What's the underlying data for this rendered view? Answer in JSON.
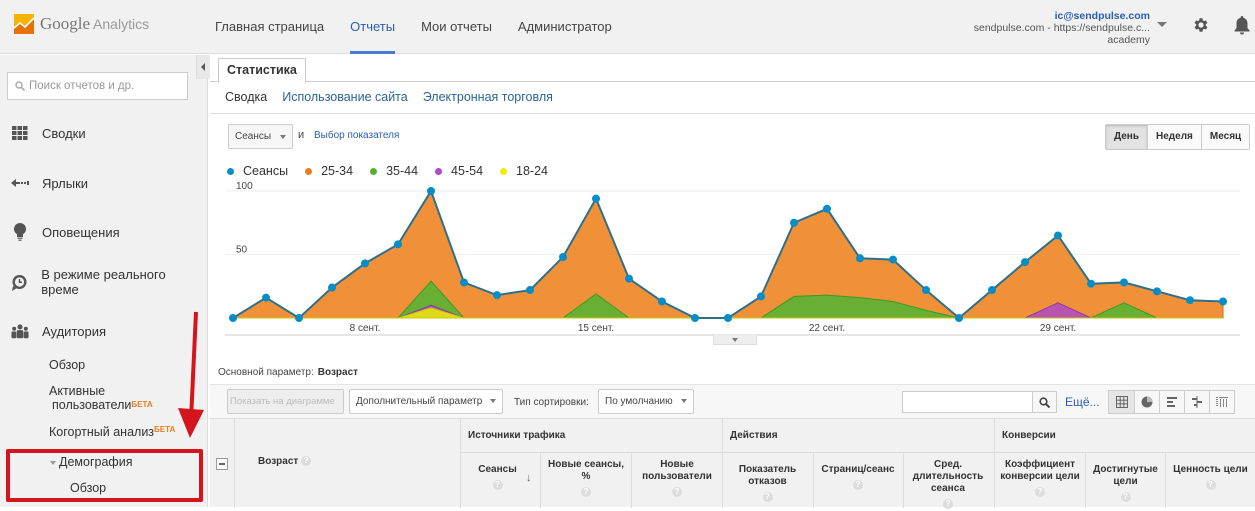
{
  "header": {
    "logo_google": "Google",
    "logo_product": "Analytics",
    "nav": [
      {
        "label": "Главная страница",
        "active": false
      },
      {
        "label": "Отчеты",
        "active": true
      },
      {
        "label": "Мои отчеты",
        "active": false
      },
      {
        "label": "Администратор",
        "active": false
      }
    ],
    "account_email": "ic@sendpulse.com",
    "account_property": "sendpulse.com - https://sendpulse.c...",
    "account_view": "academy"
  },
  "sidebar": {
    "search_placeholder": "Поиск отчетов и др.",
    "items": [
      {
        "label": "Сводки",
        "icon": "grid-icon"
      },
      {
        "label": "Ярлыки",
        "icon": "shortcut-arrow-icon"
      },
      {
        "label": "Оповещения",
        "icon": "lightbulb-icon"
      },
      {
        "label": "В режиме реального време",
        "icon": "clock-icon"
      },
      {
        "label": "Аудитория",
        "icon": "people-icon"
      }
    ],
    "audience_sub": {
      "overview": "Обзор",
      "active_users_1": "Активные",
      "active_users_2": "пользователи",
      "cohort": "Когортный анализ",
      "beta": "БЕТА",
      "demographics": "Демография",
      "demographics_overview": "Обзор"
    }
  },
  "main": {
    "tab": "Статистика",
    "subtabs": [
      {
        "label": "Сводка",
        "active": true
      },
      {
        "label": "Использование сайта",
        "active": false
      },
      {
        "label": "Электронная торговля",
        "active": false
      }
    ],
    "metric_select": "Сеансы",
    "and_label": "и",
    "choose_metric": "Выбор показателя",
    "period": [
      "День",
      "Неделя",
      "Месяц"
    ],
    "period_selected": "День",
    "primary_dimension_label": "Основной параметр:",
    "primary_dimension_value": "Возраст",
    "toolbar": {
      "plot_rows": "Показать на диаграмме",
      "secondary_dim": "Дополнительный параметр",
      "sort_type_label": "Тип сортировки:",
      "sort_type_value": "По умолчанию",
      "more": "Ещё..."
    },
    "table": {
      "dimension": "Возраст",
      "groups": [
        "Источники трафика",
        "Действия",
        "Конверсии"
      ],
      "columns": [
        "Сеансы",
        "Новые сеансы, %",
        "Новые пользователи",
        "Показатель отказов",
        "Страниц/сеанс",
        "Сред. длительность сеанса",
        "Коэффициент конверсии цели",
        "Достигнутые цели",
        "Ценность цели"
      ]
    }
  },
  "chart_data": {
    "type": "area",
    "title": "",
    "xlabel": "",
    "ylabel": "",
    "ylim": [
      0,
      100
    ],
    "yticks": [
      50,
      100
    ],
    "x_tick_labels": [
      {
        "index": 4,
        "label": "8 сент."
      },
      {
        "index": 11,
        "label": "15 сент."
      },
      {
        "index": 18,
        "label": "22 сент."
      },
      {
        "index": 25,
        "label": "29 сент."
      }
    ],
    "grid": true,
    "legend_position": "top-left",
    "series": [
      {
        "name": "Сеансы",
        "color": "#058dc7",
        "values": [
          0,
          16,
          0,
          24,
          43,
          58,
          100,
          28,
          18,
          22,
          48,
          94,
          31,
          13,
          0,
          0,
          17,
          75,
          86,
          47,
          46,
          22,
          0,
          22,
          44,
          65,
          27,
          28,
          21,
          14,
          13
        ]
      },
      {
        "name": "25-34",
        "color": "#ed7e17",
        "values": [
          0,
          16,
          0,
          24,
          43,
          58,
          100,
          28,
          18,
          22,
          48,
          94,
          31,
          13,
          0,
          0,
          17,
          75,
          86,
          47,
          46,
          22,
          0,
          22,
          44,
          65,
          27,
          28,
          21,
          14,
          13
        ]
      },
      {
        "name": "35-44",
        "color": "#50b432",
        "values": [
          0,
          0,
          0,
          0,
          0,
          0,
          29,
          0,
          0,
          0,
          0,
          19,
          0,
          0,
          0,
          0,
          0,
          17,
          18,
          16,
          13,
          6,
          0,
          0,
          0,
          0,
          0,
          12,
          0,
          0,
          0
        ]
      },
      {
        "name": "45-54",
        "color": "#af49c5",
        "values": [
          0,
          0,
          0,
          0,
          0,
          0,
          10,
          0,
          0,
          0,
          0,
          0,
          0,
          0,
          0,
          0,
          0,
          0,
          0,
          0,
          0,
          0,
          0,
          0,
          0,
          12,
          0,
          0,
          0,
          0,
          0
        ]
      },
      {
        "name": "18-24",
        "color": "#edef00",
        "values": [
          0,
          0,
          0,
          0,
          0,
          0,
          8,
          0,
          0,
          0,
          0,
          0,
          0,
          0,
          0,
          0,
          0,
          0,
          0,
          0,
          0,
          0,
          0,
          0,
          0,
          0,
          0,
          0,
          0,
          0,
          0
        ]
      }
    ]
  }
}
